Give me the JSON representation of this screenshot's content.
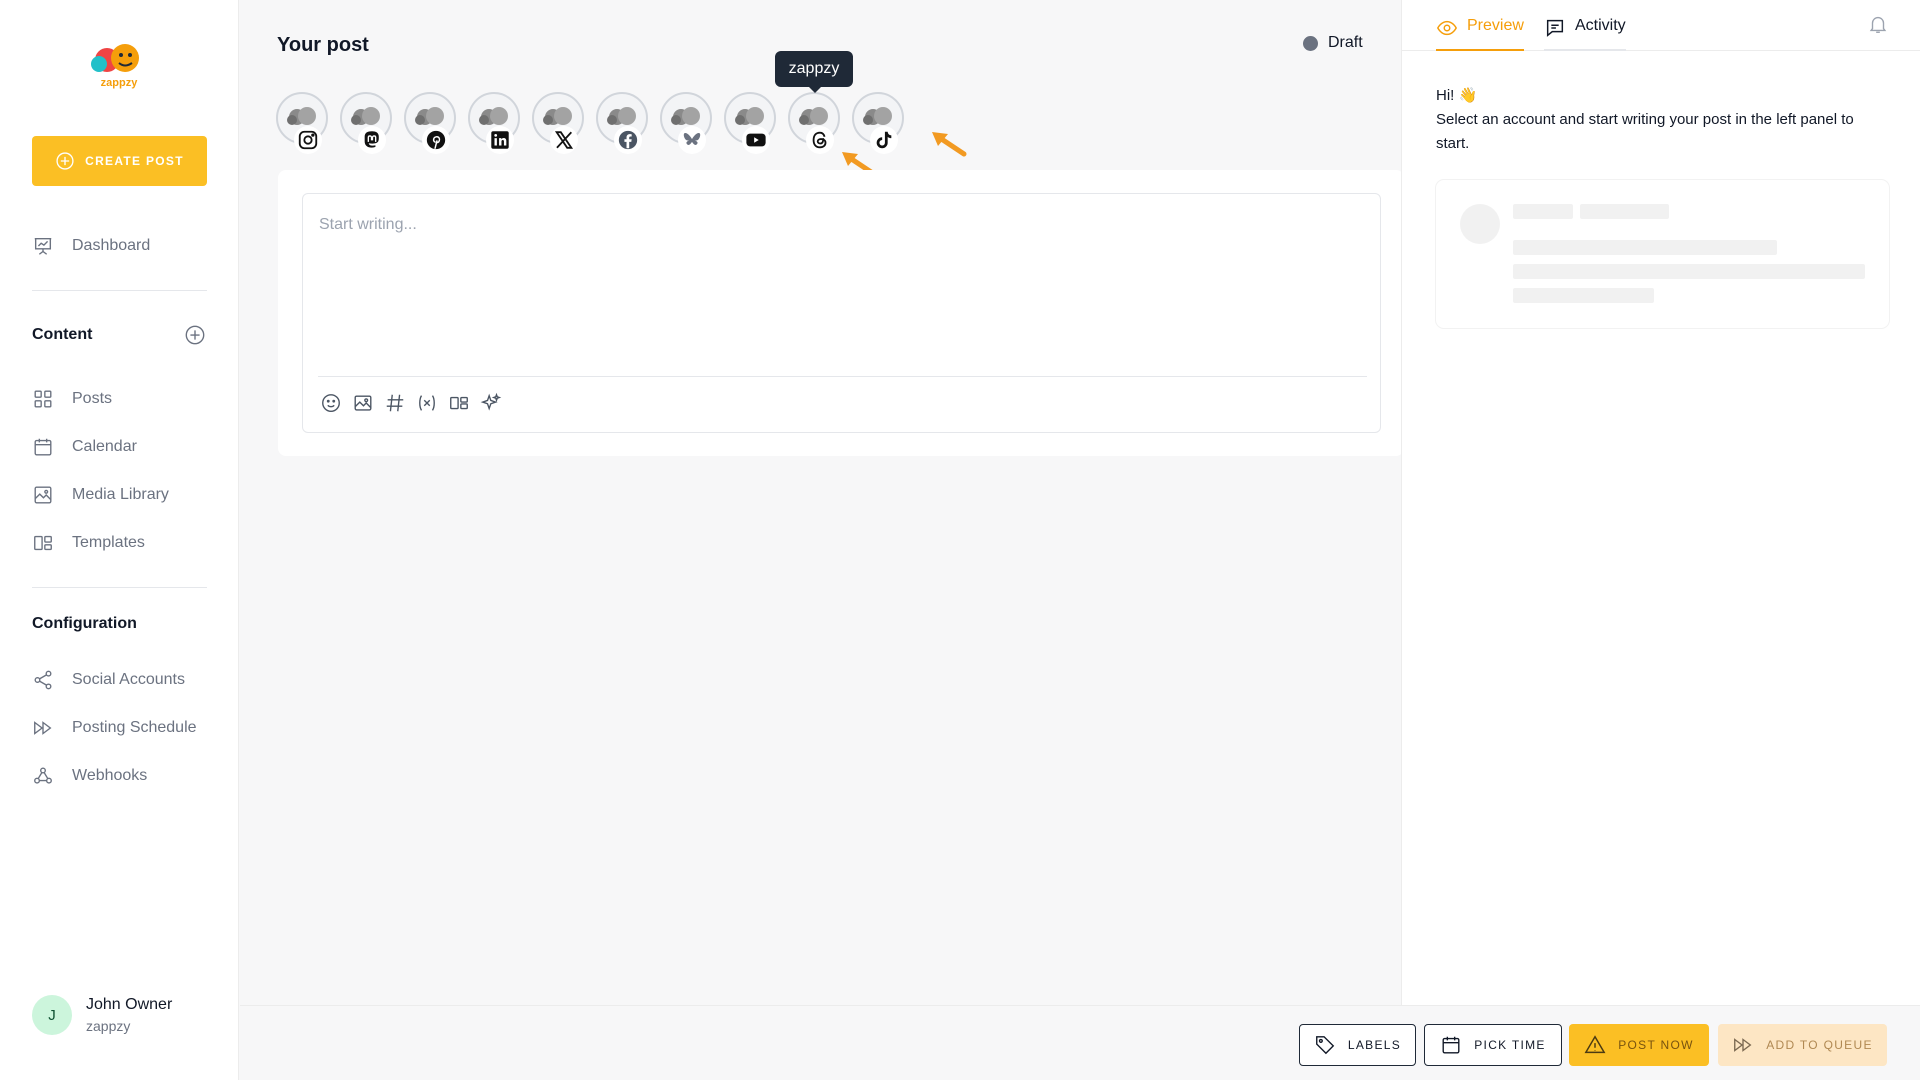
{
  "app": {
    "logo_text": "zappzy"
  },
  "sidebar": {
    "create_post": "CREATE POST",
    "dashboard": "Dashboard",
    "content_title": "Content",
    "content_items": [
      {
        "label": "Posts",
        "icon": "grid-icon"
      },
      {
        "label": "Calendar",
        "icon": "calendar-icon"
      },
      {
        "label": "Media Library",
        "icon": "image-icon"
      },
      {
        "label": "Templates",
        "icon": "templates-icon"
      }
    ],
    "config_title": "Configuration",
    "config_items": [
      {
        "label": "Social Accounts",
        "icon": "share-icon"
      },
      {
        "label": "Posting Schedule",
        "icon": "fast-forward-icon"
      },
      {
        "label": "Webhooks",
        "icon": "webhook-icon"
      }
    ],
    "user": {
      "initial": "J",
      "name": "John Owner",
      "org": "zappzy"
    }
  },
  "main": {
    "title": "Your post",
    "status": "Draft",
    "tooltip": "zappzy",
    "accounts": [
      "instagram",
      "mastodon",
      "pinterest",
      "linkedin",
      "x",
      "facebook",
      "bluesky",
      "youtube",
      "threads",
      "tiktok"
    ],
    "editor_placeholder": "Start writing...",
    "tools": [
      "emoji-icon",
      "image-icon",
      "hashtag-icon",
      "variable-icon",
      "templates-icon",
      "ai-sparkle-icon"
    ]
  },
  "right_panel": {
    "tab_preview": "Preview",
    "tab_activity": "Activity",
    "greeting_line1": "Hi! 👋",
    "greeting_line2": "Select an account and start writing your post in the left panel to start."
  },
  "bottom_bar": {
    "labels": "LABELS",
    "pick_time": "PICK TIME",
    "post_now": "POST NOW",
    "add_to_queue": "ADD TO QUEUE"
  },
  "colors": {
    "accent": "#fbbf24",
    "accent_text": "#f59e0b",
    "draft_dot": "#6b7280",
    "annotation_arrow": "#f29a22"
  }
}
